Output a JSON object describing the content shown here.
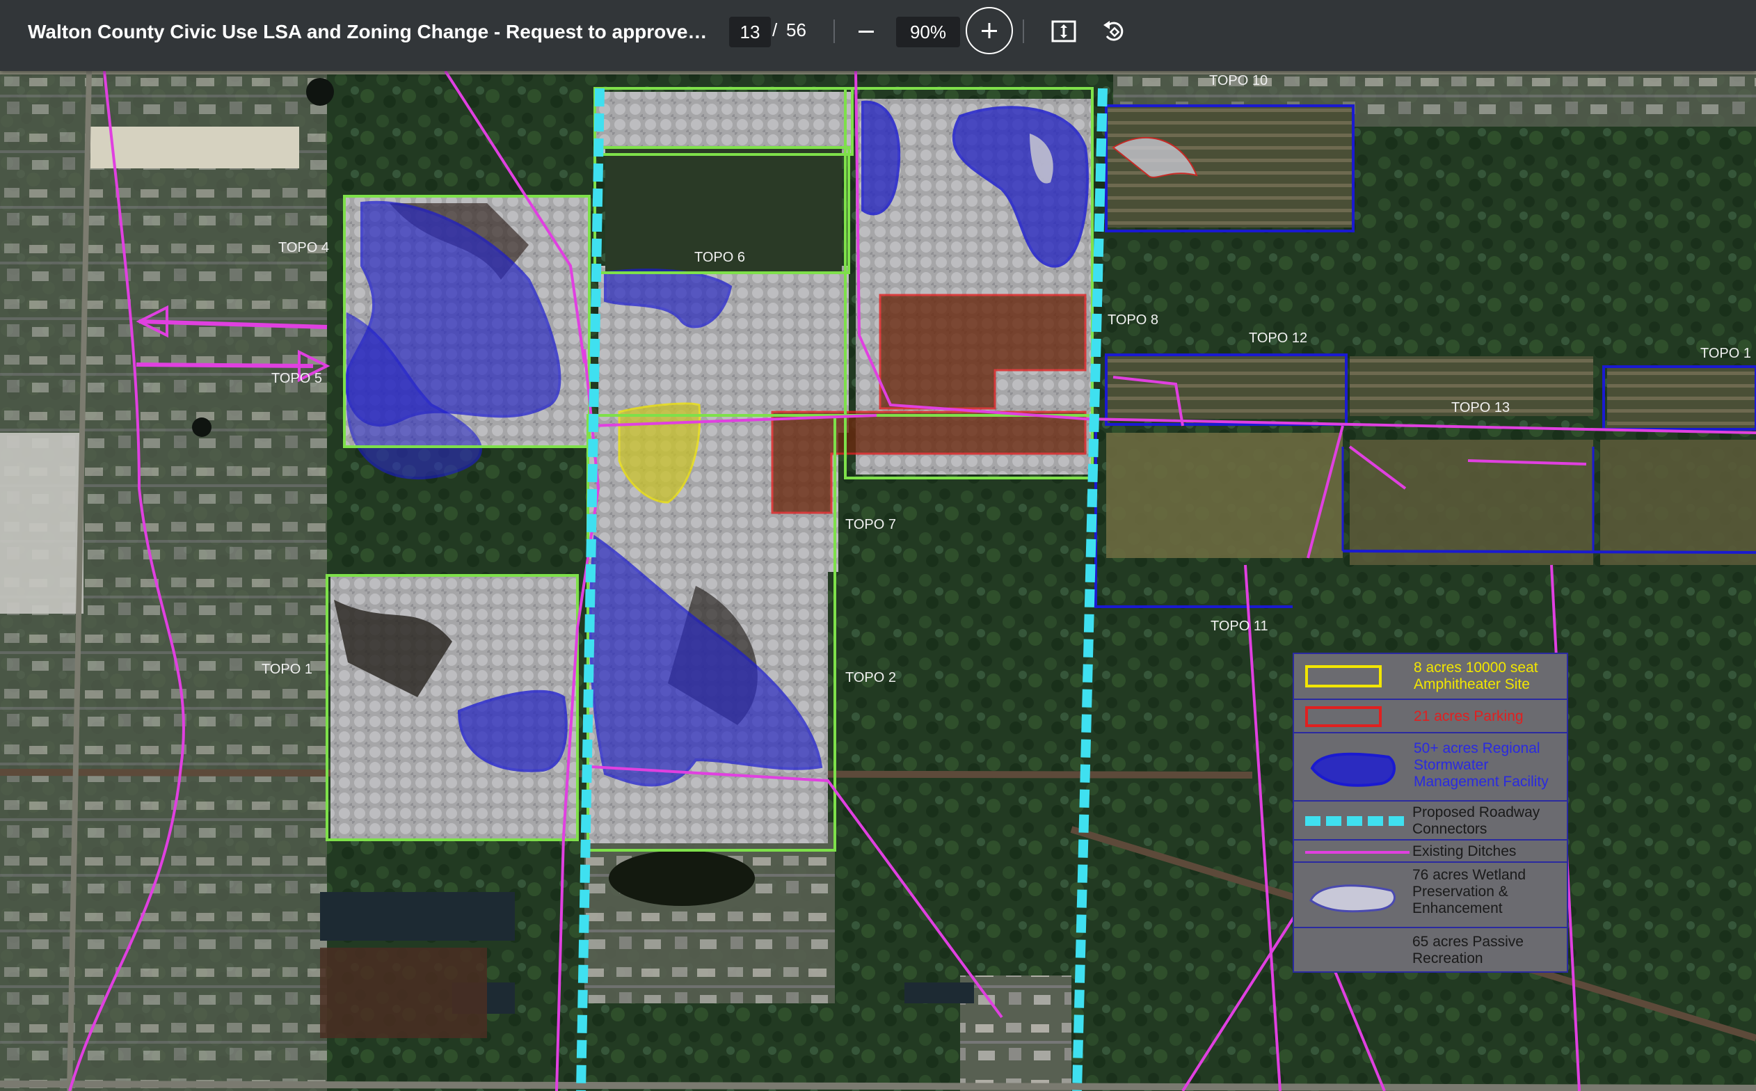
{
  "toolbar": {
    "title": "Walton County Civic Use LSA and Zoning Change - Request to approve by or...",
    "current_page": "13",
    "page_separator": "/",
    "total_pages": "56",
    "zoom": "90%"
  },
  "map": {
    "topo_labels": [
      "TOPO 10",
      "TOPO 4",
      "TOPO 6",
      "TOPO 5",
      "TOPO 8",
      "TOPO 12",
      "TOPO 13",
      "TOPO 7",
      "TOPO 1",
      "TOPO 2",
      "TOPO 11",
      "TOPO 1"
    ]
  },
  "legend": {
    "amphitheater": "8 acres  10000 seat Amphitheater Site",
    "parking": "21 acres Parking",
    "stormwater": "50+ acres Regional Stormwater Management Facility",
    "roadway": "Proposed Roadway Connectors",
    "ditches": "Existing Ditches",
    "wetland": "76 acres Wetland Preservation & Enhancement",
    "recreation": "65 acres Passive Recreation"
  },
  "colors": {
    "toolbar_bg": "#323639",
    "amphitheater": "#f2e600",
    "parking": "#e02020",
    "stormwater": "#1a1ad0",
    "roadway": "#3fe0f0",
    "ditches": "#e040e0",
    "lot_boundary": "#7ee04a",
    "legend_bg": "#6b6b70"
  }
}
